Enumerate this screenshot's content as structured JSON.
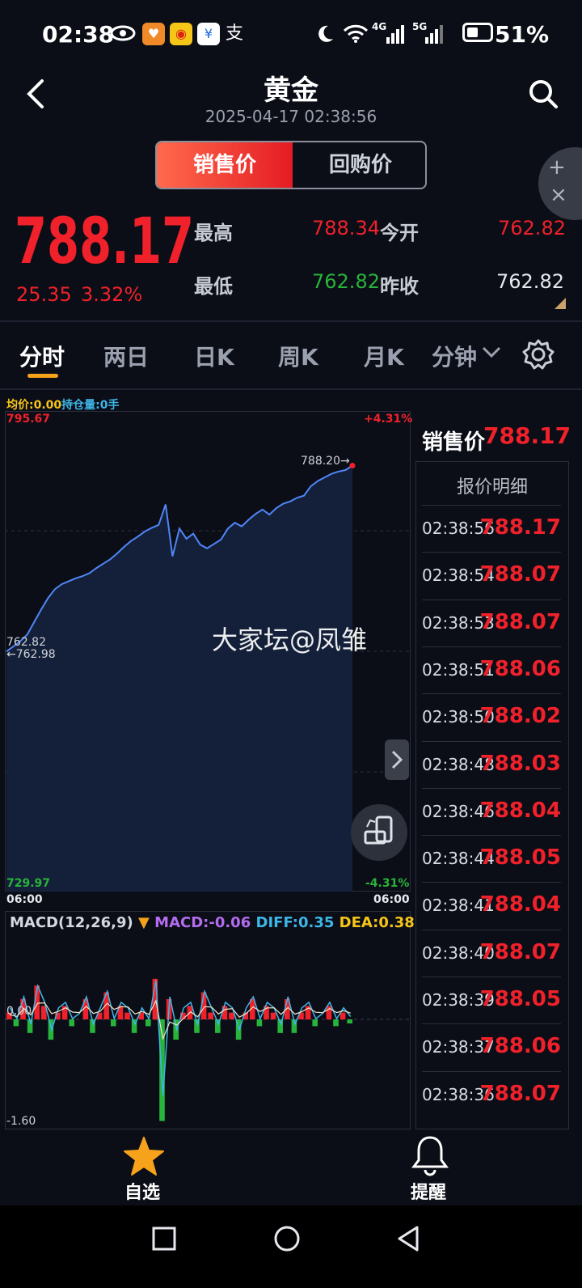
{
  "status_bar": {
    "time": "02:38",
    "net1": "4G",
    "net2": "5G",
    "battery_percent": "51%",
    "battery_level": 0.51,
    "app_icons": [
      "eye-icon",
      "heart-app-icon",
      "weibo-icon",
      "tag-app-icon",
      "alipay-icon"
    ],
    "alipay_glyph": "支"
  },
  "header": {
    "title": "黄金",
    "datetime": "2025-04-17 02:38:56",
    "seg_sell": "销售价",
    "seg_buyback": "回购价",
    "float_plus": "+",
    "float_close": "×"
  },
  "quote": {
    "price": "788.17",
    "change": "25.35",
    "change_pct": "3.32%",
    "high_label": "最高",
    "high_value": "788.34",
    "open_label": "今开",
    "open_value": "762.82",
    "low_label": "最低",
    "low_value": "762.82",
    "prev_close_label": "昨收",
    "prev_close_value": "762.82"
  },
  "tabs": [
    "分时",
    "两日",
    "日K",
    "周K",
    "月K",
    "分钟"
  ],
  "chart_labels": {
    "avg_label": "均价:0.00",
    "hold_label": "持仓量:0手",
    "top_left": "795.67",
    "top_right": "+4.31%",
    "bottom_left": "729.97",
    "bottom_right": "-4.31%",
    "x_start": "06:00",
    "x_end": "06:00",
    "last_marker": "788.20→",
    "base_value": "762.82",
    "base_arrow": "←762.98",
    "watermark": "大家坛@凤雏"
  },
  "macd": {
    "name": "MACD(12,26,9)",
    "arrow": "▼",
    "macd_val": "MACD:-0.06",
    "diff_val": "DIFF:0.35",
    "dea_val": "DEA:0.38",
    "zero_label": "0.00",
    "min_label": "-1.60"
  },
  "side": {
    "label": "销售价",
    "value": "788.17",
    "detail_title": "报价明细",
    "rows": [
      {
        "time": "02:38:56",
        "price": "788.17"
      },
      {
        "time": "02:38:54",
        "price": "788.07"
      },
      {
        "time": "02:38:53",
        "price": "788.07"
      },
      {
        "time": "02:38:51",
        "price": "788.06"
      },
      {
        "time": "02:38:50",
        "price": "788.02"
      },
      {
        "time": "02:38:48",
        "price": "788.03"
      },
      {
        "time": "02:38:46",
        "price": "788.04"
      },
      {
        "time": "02:38:44",
        "price": "788.05"
      },
      {
        "time": "02:38:41",
        "price": "788.04"
      },
      {
        "time": "02:38:40",
        "price": "788.07"
      },
      {
        "time": "02:38:39",
        "price": "788.05"
      },
      {
        "time": "02:38:37",
        "price": "788.06"
      },
      {
        "time": "02:38:36",
        "price": "788.07"
      }
    ]
  },
  "bottom_nav": {
    "watchlist": "自选",
    "alert": "提醒"
  },
  "colors": {
    "up": "#f0212a",
    "down": "#28b33a",
    "line": "#4f86f7",
    "accent": "#f7a21b",
    "bg": "#0b0e17"
  },
  "chart_data": [
    {
      "type": "line",
      "ylim": [
        729.97,
        795.67
      ],
      "baseline": 762.82,
      "series": [
        {
          "values": [
            762.8,
            763.5,
            764.2,
            765.1,
            766.8,
            768.5,
            770.1,
            771.3,
            772.0,
            772.4,
            772.8,
            773.1,
            773.5,
            774.2,
            774.8,
            775.4,
            776.2,
            777.1,
            777.9,
            778.5,
            779.2,
            779.7,
            780.1,
            782.9,
            775.8,
            779.6,
            778.2,
            778.9,
            777.4,
            776.9,
            777.5,
            778.1,
            779.6,
            780.4,
            779.9,
            780.8,
            781.6,
            782.2,
            781.5,
            782.4,
            783.0,
            783.3,
            783.8,
            784.1,
            785.4,
            786.1,
            786.6,
            787.1,
            787.4,
            787.6,
            788.2
          ]
        }
      ]
    },
    {
      "type": "bar",
      "ylim": [
        -1.6,
        1.0
      ],
      "series": [
        {
          "name": "MACD",
          "values": [
            0.1,
            -0.1,
            0.3,
            -0.2,
            0.5,
            0.2,
            -0.3,
            0.1,
            0.2,
            -0.1,
            0.0,
            0.3,
            -0.2,
            0.1,
            0.4,
            -0.1,
            0.2,
            0.1,
            -0.2,
            0.1,
            -0.1,
            0.6,
            -1.5,
            0.3,
            -0.3,
            0.1,
            0.2,
            -0.2,
            0.4,
            0.1,
            -0.2,
            0.2,
            0.1,
            -0.3,
            0.1,
            0.3,
            -0.1,
            0.2,
            0.1,
            -0.2,
            0.3,
            -0.2,
            0.1,
            0.2,
            -0.1,
            0.0,
            0.2,
            -0.1,
            0.1,
            -0.06
          ]
        }
      ]
    }
  ]
}
